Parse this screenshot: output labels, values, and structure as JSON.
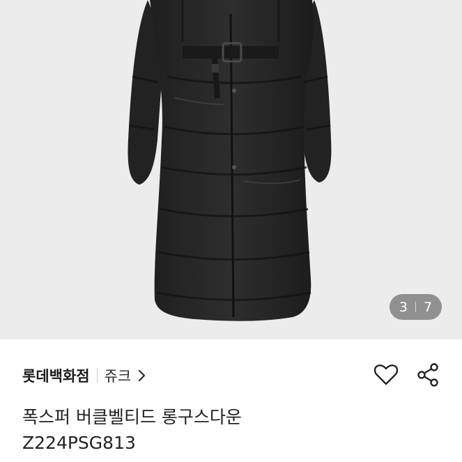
{
  "product_image": {
    "description_icon": "coat-photo",
    "pager": {
      "current": "3",
      "total": "7"
    }
  },
  "product_info": {
    "store_name": "롯데백화점",
    "brand_name": "쥬크",
    "title": "폭스퍼 버클벨티드 롱구스다운",
    "code": "Z224PSG813"
  },
  "actions": {
    "like_icon": "heart-icon",
    "share_icon": "share-icon"
  },
  "colors": {
    "background": "#ececec",
    "pager_bg": "rgba(70,70,70,0.55)",
    "text": "#222222"
  }
}
